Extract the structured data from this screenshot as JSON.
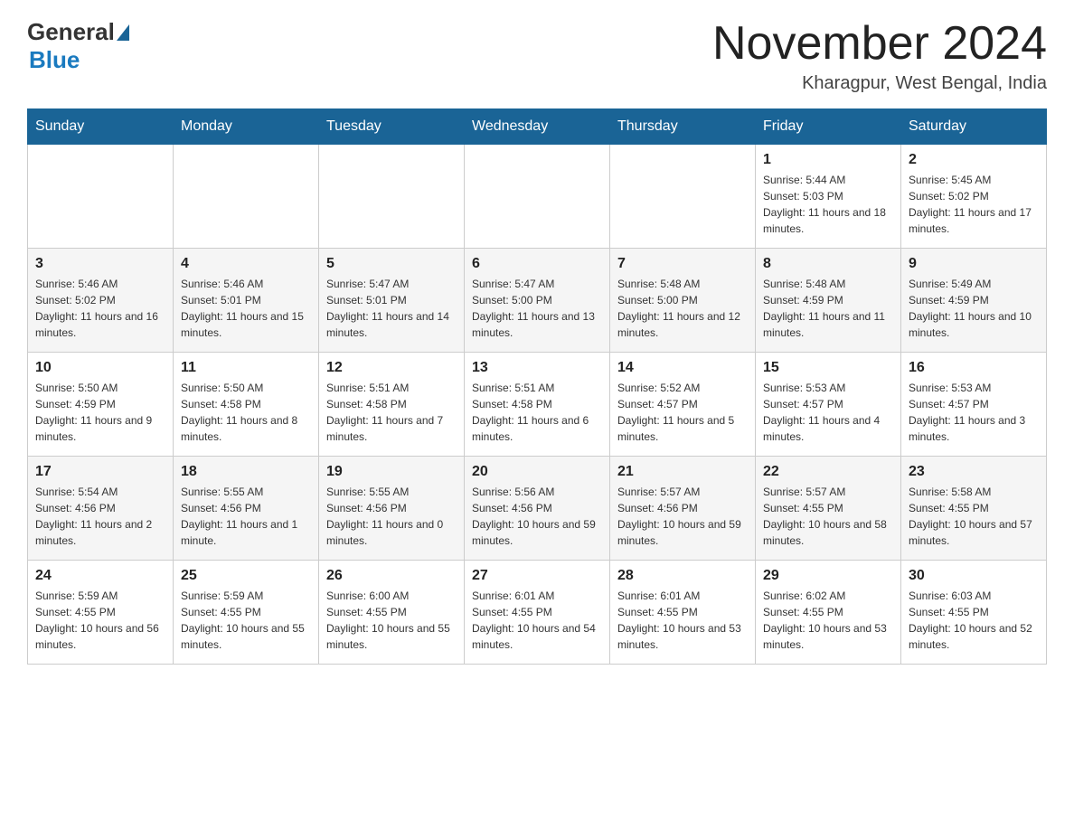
{
  "logo": {
    "general": "General",
    "blue": "Blue",
    "subtitle": ""
  },
  "title": "November 2024",
  "location": "Kharagpur, West Bengal, India",
  "days_of_week": [
    "Sunday",
    "Monday",
    "Tuesday",
    "Wednesday",
    "Thursday",
    "Friday",
    "Saturday"
  ],
  "weeks": [
    [
      {
        "day": "",
        "sunrise": "",
        "sunset": "",
        "daylight": ""
      },
      {
        "day": "",
        "sunrise": "",
        "sunset": "",
        "daylight": ""
      },
      {
        "day": "",
        "sunrise": "",
        "sunset": "",
        "daylight": ""
      },
      {
        "day": "",
        "sunrise": "",
        "sunset": "",
        "daylight": ""
      },
      {
        "day": "",
        "sunrise": "",
        "sunset": "",
        "daylight": ""
      },
      {
        "day": "1",
        "sunrise": "Sunrise: 5:44 AM",
        "sunset": "Sunset: 5:03 PM",
        "daylight": "Daylight: 11 hours and 18 minutes."
      },
      {
        "day": "2",
        "sunrise": "Sunrise: 5:45 AM",
        "sunset": "Sunset: 5:02 PM",
        "daylight": "Daylight: 11 hours and 17 minutes."
      }
    ],
    [
      {
        "day": "3",
        "sunrise": "Sunrise: 5:46 AM",
        "sunset": "Sunset: 5:02 PM",
        "daylight": "Daylight: 11 hours and 16 minutes."
      },
      {
        "day": "4",
        "sunrise": "Sunrise: 5:46 AM",
        "sunset": "Sunset: 5:01 PM",
        "daylight": "Daylight: 11 hours and 15 minutes."
      },
      {
        "day": "5",
        "sunrise": "Sunrise: 5:47 AM",
        "sunset": "Sunset: 5:01 PM",
        "daylight": "Daylight: 11 hours and 14 minutes."
      },
      {
        "day": "6",
        "sunrise": "Sunrise: 5:47 AM",
        "sunset": "Sunset: 5:00 PM",
        "daylight": "Daylight: 11 hours and 13 minutes."
      },
      {
        "day": "7",
        "sunrise": "Sunrise: 5:48 AM",
        "sunset": "Sunset: 5:00 PM",
        "daylight": "Daylight: 11 hours and 12 minutes."
      },
      {
        "day": "8",
        "sunrise": "Sunrise: 5:48 AM",
        "sunset": "Sunset: 4:59 PM",
        "daylight": "Daylight: 11 hours and 11 minutes."
      },
      {
        "day": "9",
        "sunrise": "Sunrise: 5:49 AM",
        "sunset": "Sunset: 4:59 PM",
        "daylight": "Daylight: 11 hours and 10 minutes."
      }
    ],
    [
      {
        "day": "10",
        "sunrise": "Sunrise: 5:50 AM",
        "sunset": "Sunset: 4:59 PM",
        "daylight": "Daylight: 11 hours and 9 minutes."
      },
      {
        "day": "11",
        "sunrise": "Sunrise: 5:50 AM",
        "sunset": "Sunset: 4:58 PM",
        "daylight": "Daylight: 11 hours and 8 minutes."
      },
      {
        "day": "12",
        "sunrise": "Sunrise: 5:51 AM",
        "sunset": "Sunset: 4:58 PM",
        "daylight": "Daylight: 11 hours and 7 minutes."
      },
      {
        "day": "13",
        "sunrise": "Sunrise: 5:51 AM",
        "sunset": "Sunset: 4:58 PM",
        "daylight": "Daylight: 11 hours and 6 minutes."
      },
      {
        "day": "14",
        "sunrise": "Sunrise: 5:52 AM",
        "sunset": "Sunset: 4:57 PM",
        "daylight": "Daylight: 11 hours and 5 minutes."
      },
      {
        "day": "15",
        "sunrise": "Sunrise: 5:53 AM",
        "sunset": "Sunset: 4:57 PM",
        "daylight": "Daylight: 11 hours and 4 minutes."
      },
      {
        "day": "16",
        "sunrise": "Sunrise: 5:53 AM",
        "sunset": "Sunset: 4:57 PM",
        "daylight": "Daylight: 11 hours and 3 minutes."
      }
    ],
    [
      {
        "day": "17",
        "sunrise": "Sunrise: 5:54 AM",
        "sunset": "Sunset: 4:56 PM",
        "daylight": "Daylight: 11 hours and 2 minutes."
      },
      {
        "day": "18",
        "sunrise": "Sunrise: 5:55 AM",
        "sunset": "Sunset: 4:56 PM",
        "daylight": "Daylight: 11 hours and 1 minute."
      },
      {
        "day": "19",
        "sunrise": "Sunrise: 5:55 AM",
        "sunset": "Sunset: 4:56 PM",
        "daylight": "Daylight: 11 hours and 0 minutes."
      },
      {
        "day": "20",
        "sunrise": "Sunrise: 5:56 AM",
        "sunset": "Sunset: 4:56 PM",
        "daylight": "Daylight: 10 hours and 59 minutes."
      },
      {
        "day": "21",
        "sunrise": "Sunrise: 5:57 AM",
        "sunset": "Sunset: 4:56 PM",
        "daylight": "Daylight: 10 hours and 59 minutes."
      },
      {
        "day": "22",
        "sunrise": "Sunrise: 5:57 AM",
        "sunset": "Sunset: 4:55 PM",
        "daylight": "Daylight: 10 hours and 58 minutes."
      },
      {
        "day": "23",
        "sunrise": "Sunrise: 5:58 AM",
        "sunset": "Sunset: 4:55 PM",
        "daylight": "Daylight: 10 hours and 57 minutes."
      }
    ],
    [
      {
        "day": "24",
        "sunrise": "Sunrise: 5:59 AM",
        "sunset": "Sunset: 4:55 PM",
        "daylight": "Daylight: 10 hours and 56 minutes."
      },
      {
        "day": "25",
        "sunrise": "Sunrise: 5:59 AM",
        "sunset": "Sunset: 4:55 PM",
        "daylight": "Daylight: 10 hours and 55 minutes."
      },
      {
        "day": "26",
        "sunrise": "Sunrise: 6:00 AM",
        "sunset": "Sunset: 4:55 PM",
        "daylight": "Daylight: 10 hours and 55 minutes."
      },
      {
        "day": "27",
        "sunrise": "Sunrise: 6:01 AM",
        "sunset": "Sunset: 4:55 PM",
        "daylight": "Daylight: 10 hours and 54 minutes."
      },
      {
        "day": "28",
        "sunrise": "Sunrise: 6:01 AM",
        "sunset": "Sunset: 4:55 PM",
        "daylight": "Daylight: 10 hours and 53 minutes."
      },
      {
        "day": "29",
        "sunrise": "Sunrise: 6:02 AM",
        "sunset": "Sunset: 4:55 PM",
        "daylight": "Daylight: 10 hours and 53 minutes."
      },
      {
        "day": "30",
        "sunrise": "Sunrise: 6:03 AM",
        "sunset": "Sunset: 4:55 PM",
        "daylight": "Daylight: 10 hours and 52 minutes."
      }
    ]
  ]
}
